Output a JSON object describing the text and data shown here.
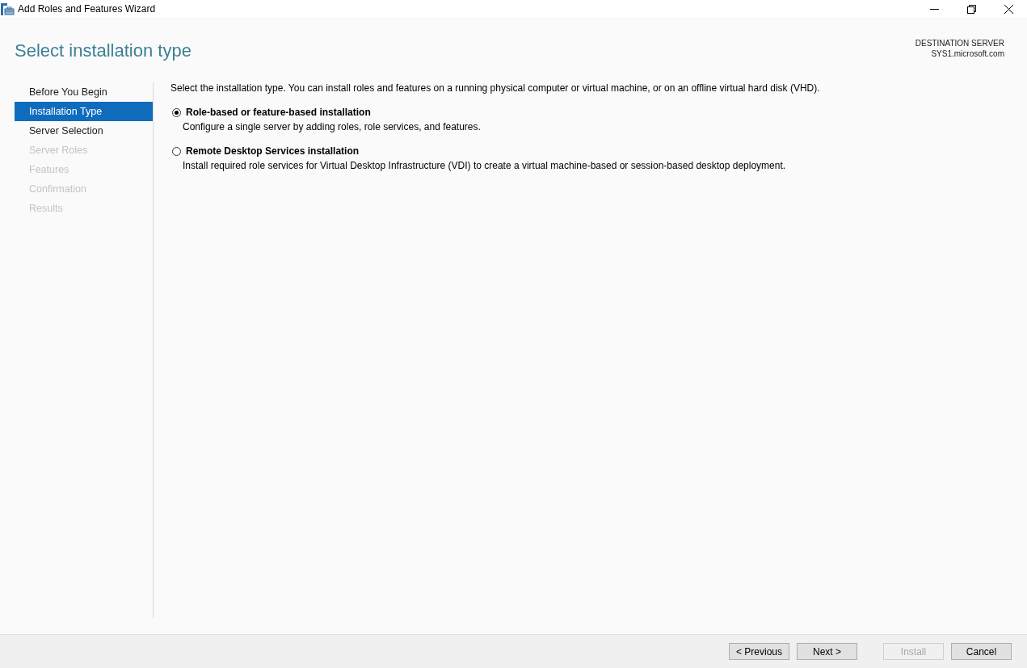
{
  "window": {
    "title": "Add Roles and Features Wizard"
  },
  "page_title": "Select installation type",
  "destination_server": {
    "label": "DESTINATION SERVER",
    "name": "SYS1.microsoft.com"
  },
  "steps": [
    {
      "label": "Before You Begin",
      "selected": false,
      "disabled": false
    },
    {
      "label": "Installation Type",
      "selected": true,
      "disabled": false
    },
    {
      "label": "Server Selection",
      "selected": false,
      "disabled": false
    },
    {
      "label": "Server Roles",
      "selected": false,
      "disabled": true
    },
    {
      "label": "Features",
      "selected": false,
      "disabled": true
    },
    {
      "label": "Confirmation",
      "selected": false,
      "disabled": true
    },
    {
      "label": "Results",
      "selected": false,
      "disabled": true
    }
  ],
  "intro": "Select the installation type. You can install roles and features on a running physical computer or virtual machine, or on an offline virtual hard disk (VHD).",
  "options": [
    {
      "label": "Role-based or feature-based installation",
      "description": "Configure a single server by adding roles, role services, and features.",
      "selected": true
    },
    {
      "label": "Remote Desktop Services installation",
      "description": "Install required role services for Virtual Desktop Infrastructure (VDI) to create a virtual machine-based or session-based desktop deployment.",
      "selected": false
    }
  ],
  "nav_buttons": [
    {
      "label": "< Previous",
      "disabled": false
    },
    {
      "label": "Next >",
      "disabled": false
    }
  ],
  "action_buttons": [
    {
      "label": "Install",
      "disabled": true
    },
    {
      "label": "Cancel",
      "disabled": false
    }
  ]
}
